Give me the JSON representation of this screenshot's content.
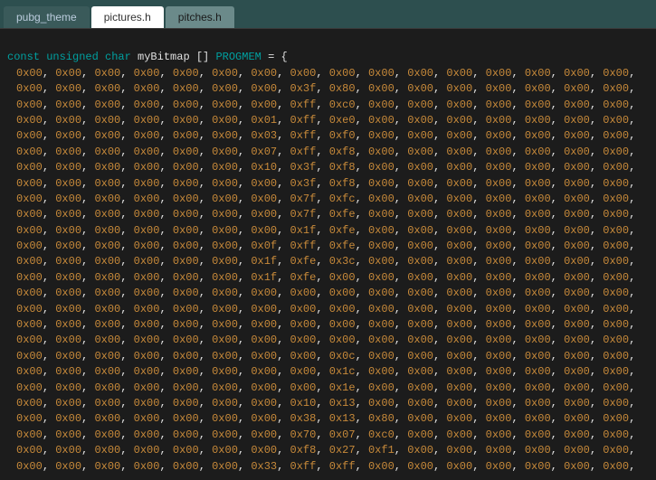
{
  "tabs": [
    {
      "label": "pubg_theme",
      "active": false,
      "style": "dim"
    },
    {
      "label": "pictures.h",
      "active": true,
      "style": "active"
    },
    {
      "label": "pitches.h",
      "active": false,
      "style": "inactive"
    }
  ],
  "declaration": {
    "keywords": "const unsigned char",
    "identifier": "myBitmap",
    "brackets": "[]",
    "progmem": "PROGMEM",
    "eq_brace": "= {"
  },
  "hex_rows": [
    [
      "0x00",
      "0x00",
      "0x00",
      "0x00",
      "0x00",
      "0x00",
      "0x00",
      "0x00",
      "0x00",
      "0x00",
      "0x00",
      "0x00",
      "0x00",
      "0x00",
      "0x00",
      "0x00"
    ],
    [
      "0x00",
      "0x00",
      "0x00",
      "0x00",
      "0x00",
      "0x00",
      "0x00",
      "0x3f",
      "0x80",
      "0x00",
      "0x00",
      "0x00",
      "0x00",
      "0x00",
      "0x00",
      "0x00"
    ],
    [
      "0x00",
      "0x00",
      "0x00",
      "0x00",
      "0x00",
      "0x00",
      "0x00",
      "0xff",
      "0xc0",
      "0x00",
      "0x00",
      "0x00",
      "0x00",
      "0x00",
      "0x00",
      "0x00"
    ],
    [
      "0x00",
      "0x00",
      "0x00",
      "0x00",
      "0x00",
      "0x00",
      "0x01",
      "0xff",
      "0xe0",
      "0x00",
      "0x00",
      "0x00",
      "0x00",
      "0x00",
      "0x00",
      "0x00"
    ],
    [
      "0x00",
      "0x00",
      "0x00",
      "0x00",
      "0x00",
      "0x00",
      "0x03",
      "0xff",
      "0xf0",
      "0x00",
      "0x00",
      "0x00",
      "0x00",
      "0x00",
      "0x00",
      "0x00"
    ],
    [
      "0x00",
      "0x00",
      "0x00",
      "0x00",
      "0x00",
      "0x00",
      "0x07",
      "0xff",
      "0xf8",
      "0x00",
      "0x00",
      "0x00",
      "0x00",
      "0x00",
      "0x00",
      "0x00"
    ],
    [
      "0x00",
      "0x00",
      "0x00",
      "0x00",
      "0x00",
      "0x00",
      "0x10",
      "0x3f",
      "0xf8",
      "0x00",
      "0x00",
      "0x00",
      "0x00",
      "0x00",
      "0x00",
      "0x00"
    ],
    [
      "0x00",
      "0x00",
      "0x00",
      "0x00",
      "0x00",
      "0x00",
      "0x00",
      "0x3f",
      "0xf8",
      "0x00",
      "0x00",
      "0x00",
      "0x00",
      "0x00",
      "0x00",
      "0x00"
    ],
    [
      "0x00",
      "0x00",
      "0x00",
      "0x00",
      "0x00",
      "0x00",
      "0x00",
      "0x7f",
      "0xfc",
      "0x00",
      "0x00",
      "0x00",
      "0x00",
      "0x00",
      "0x00",
      "0x00"
    ],
    [
      "0x00",
      "0x00",
      "0x00",
      "0x00",
      "0x00",
      "0x00",
      "0x00",
      "0x7f",
      "0xfe",
      "0x00",
      "0x00",
      "0x00",
      "0x00",
      "0x00",
      "0x00",
      "0x00"
    ],
    [
      "0x00",
      "0x00",
      "0x00",
      "0x00",
      "0x00",
      "0x00",
      "0x00",
      "0x1f",
      "0xfe",
      "0x00",
      "0x00",
      "0x00",
      "0x00",
      "0x00",
      "0x00",
      "0x00"
    ],
    [
      "0x00",
      "0x00",
      "0x00",
      "0x00",
      "0x00",
      "0x00",
      "0x0f",
      "0xff",
      "0xfe",
      "0x00",
      "0x00",
      "0x00",
      "0x00",
      "0x00",
      "0x00",
      "0x00"
    ],
    [
      "0x00",
      "0x00",
      "0x00",
      "0x00",
      "0x00",
      "0x00",
      "0x1f",
      "0xfe",
      "0x3c",
      "0x00",
      "0x00",
      "0x00",
      "0x00",
      "0x00",
      "0x00",
      "0x00"
    ],
    [
      "0x00",
      "0x00",
      "0x00",
      "0x00",
      "0x00",
      "0x00",
      "0x1f",
      "0xfe",
      "0x00",
      "0x00",
      "0x00",
      "0x00",
      "0x00",
      "0x00",
      "0x00",
      "0x00"
    ],
    [
      "0x00",
      "0x00",
      "0x00",
      "0x00",
      "0x00",
      "0x00",
      "0x00",
      "0x00",
      "0x00",
      "0x00",
      "0x00",
      "0x00",
      "0x00",
      "0x00",
      "0x00",
      "0x00"
    ],
    [
      "0x00",
      "0x00",
      "0x00",
      "0x00",
      "0x00",
      "0x00",
      "0x00",
      "0x00",
      "0x00",
      "0x00",
      "0x00",
      "0x00",
      "0x00",
      "0x00",
      "0x00",
      "0x00"
    ],
    [
      "0x00",
      "0x00",
      "0x00",
      "0x00",
      "0x00",
      "0x00",
      "0x00",
      "0x00",
      "0x00",
      "0x00",
      "0x00",
      "0x00",
      "0x00",
      "0x00",
      "0x00",
      "0x00"
    ],
    [
      "0x00",
      "0x00",
      "0x00",
      "0x00",
      "0x00",
      "0x00",
      "0x00",
      "0x00",
      "0x00",
      "0x00",
      "0x00",
      "0x00",
      "0x00",
      "0x00",
      "0x00",
      "0x00"
    ],
    [
      "0x00",
      "0x00",
      "0x00",
      "0x00",
      "0x00",
      "0x00",
      "0x00",
      "0x00",
      "0x0c",
      "0x00",
      "0x00",
      "0x00",
      "0x00",
      "0x00",
      "0x00",
      "0x00"
    ],
    [
      "0x00",
      "0x00",
      "0x00",
      "0x00",
      "0x00",
      "0x00",
      "0x00",
      "0x00",
      "0x1c",
      "0x00",
      "0x00",
      "0x00",
      "0x00",
      "0x00",
      "0x00",
      "0x00"
    ],
    [
      "0x00",
      "0x00",
      "0x00",
      "0x00",
      "0x00",
      "0x00",
      "0x00",
      "0x00",
      "0x1e",
      "0x00",
      "0x00",
      "0x00",
      "0x00",
      "0x00",
      "0x00",
      "0x00"
    ],
    [
      "0x00",
      "0x00",
      "0x00",
      "0x00",
      "0x00",
      "0x00",
      "0x00",
      "0x10",
      "0x13",
      "0x00",
      "0x00",
      "0x00",
      "0x00",
      "0x00",
      "0x00",
      "0x00"
    ],
    [
      "0x00",
      "0x00",
      "0x00",
      "0x00",
      "0x00",
      "0x00",
      "0x00",
      "0x38",
      "0x13",
      "0x80",
      "0x00",
      "0x00",
      "0x00",
      "0x00",
      "0x00",
      "0x00"
    ],
    [
      "0x00",
      "0x00",
      "0x00",
      "0x00",
      "0x00",
      "0x00",
      "0x00",
      "0x70",
      "0x07",
      "0xc0",
      "0x00",
      "0x00",
      "0x00",
      "0x00",
      "0x00",
      "0x00"
    ],
    [
      "0x00",
      "0x00",
      "0x00",
      "0x00",
      "0x00",
      "0x00",
      "0x00",
      "0xf8",
      "0x27",
      "0xf1",
      "0x00",
      "0x00",
      "0x00",
      "0x00",
      "0x00",
      "0x00"
    ],
    [
      "0x00",
      "0x00",
      "0x00",
      "0x00",
      "0x00",
      "0x00",
      "0x33",
      "0xff",
      "0xff",
      "0x00",
      "0x00",
      "0x00",
      "0x00",
      "0x00",
      "0x00",
      "0x00"
    ]
  ]
}
